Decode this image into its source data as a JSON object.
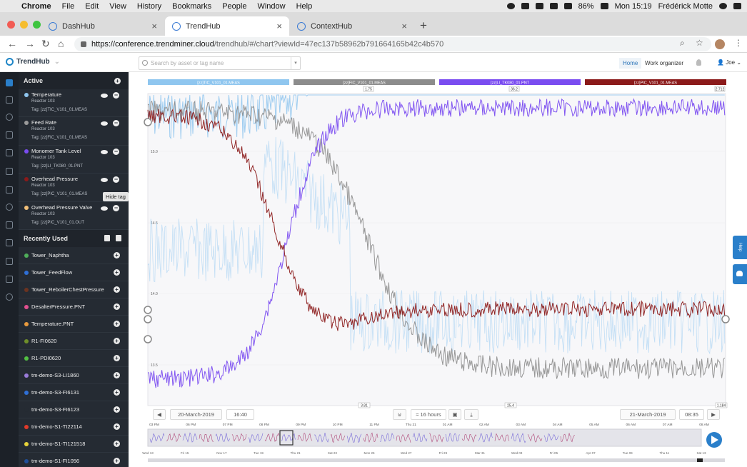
{
  "os_menubar": {
    "app": "Chrome",
    "menus": [
      "File",
      "Edit",
      "View",
      "History",
      "Bookmarks",
      "People",
      "Window",
      "Help"
    ],
    "battery": "86%",
    "clock": "Mon 15:19",
    "user": "Frédérick Motte"
  },
  "browser": {
    "tabs": [
      {
        "label": "DashHub",
        "active": false
      },
      {
        "label": "TrendHub",
        "active": true
      },
      {
        "label": "ContextHub",
        "active": false
      }
    ],
    "url_host": "https://conference.trendminer.cloud",
    "url_path": "/trendhub/#/chart?viewId=47ec137b58962b791664165b42c4b570"
  },
  "app": {
    "name": "TrendHub",
    "search_placeholder": "Search by asset or tag name",
    "nav": {
      "home": "Home",
      "work": "Work organizer"
    },
    "user": "Joe"
  },
  "panel": {
    "active_title": "Active",
    "active_tags": [
      {
        "name": "Temperature",
        "asset": "Reactor 103",
        "tag": "Tag: [zz]TIC_V101_01.MEAS",
        "color": "#8fc6ef"
      },
      {
        "name": "Feed Rate",
        "asset": "Reactor 103",
        "tag": "Tag: [zz]FIC_V101_01.MEAS",
        "color": "#9a9a9a"
      },
      {
        "name": "Monomer Tank Level",
        "asset": "Reactor 103",
        "tag": "Tag: [zz]LI_TK080_01.PNT",
        "color": "#7a4cf0"
      },
      {
        "name": "Overhead Pressure",
        "asset": "Reactor 103",
        "tag": "Tag: [zz]PIC_V101_01.MEAS",
        "color": "#8b1a1a"
      },
      {
        "name": "Overhead Pressure Valve",
        "asset": "Reactor 103",
        "tag": "Tag: [zz]PIC_V101_01.OUT",
        "color": "#f2c079"
      }
    ],
    "tooltip": "Hide tag",
    "recent_title": "Recently Used",
    "recent": [
      {
        "name": "Tower_Naphtha",
        "color": "#4fae5a"
      },
      {
        "name": "Tower_FeedFlow",
        "color": "#2f6fd6"
      },
      {
        "name": "Tower_ReboilerChestPressure",
        "color": "#6b3320"
      },
      {
        "name": "DesalterPressure.PNT",
        "color": "#e2508f"
      },
      {
        "name": "Temperature.PNT",
        "color": "#e89a3e"
      },
      {
        "name": "R1-FI0620",
        "color": "#6f8f2a"
      },
      {
        "name": "R1-PDI0620",
        "color": "#53c043"
      },
      {
        "name": "tm-demo-S3-LI1860",
        "color": "#9a7bd8"
      },
      {
        "name": "tm-demo-S3-FI6131",
        "color": "#2f6fd6"
      },
      {
        "name": "tm-demo-S3-FI6123",
        "color": "#252b33"
      },
      {
        "name": "tm-demo-S1-TI22114",
        "color": "#e03a2a"
      },
      {
        "name": "tm-demo-S1-TI121518",
        "color": "#e6d23a"
      },
      {
        "name": "tm-demo-S1-FI1056",
        "color": "#1f4f9a"
      }
    ]
  },
  "chart": {
    "scale_headers": [
      {
        "tag": "[zz]TIC_V101_01.MEAS",
        "color": "#8fc6ef",
        "max": ""
      },
      {
        "tag": "[zz]FIC_V101_01.MEAS",
        "color": "#8c8c8c",
        "max": "1.75"
      },
      {
        "tag": "[zz]LI_TK080_01.PNT",
        "color": "#7a4cf0",
        "max": "36.2"
      },
      {
        "tag": "[zz]PIC_V101_01.MEAS",
        "color": "#8b1a1a",
        "max": "2.712"
      }
    ],
    "y_ticks": [
      "15.0",
      "14.5",
      "14.0",
      "13.5"
    ],
    "x_ticks": [
      "03 PM",
      "06 PM",
      "07 PM",
      "08 PM",
      "09 PM",
      "10 PM",
      "11 PM",
      "Thu 21",
      "01 AM",
      "02 AM",
      "03 AM",
      "04 AM",
      "05 AM",
      "06 AM",
      "07 AM",
      "08 AM"
    ],
    "bottom_mins": [
      "3.81",
      "25.4",
      "1.184"
    ],
    "start_date": "20-March-2019",
    "start_time": "16:40",
    "span": "≈ 16 hours",
    "end_date": "21-March-2019",
    "end_time": "08:35",
    "overview_ticks": [
      "Wed 13",
      "Fri 15",
      "Nov 17",
      "Tue 19",
      "Thu 21",
      "Sat 23",
      "Mon 25",
      "Wed 27",
      "Fri 29",
      "Mar 31",
      "Wed 03",
      "Fri 05",
      "Apr 07",
      "Tue 09",
      "Thu 11",
      "Sat 13"
    ],
    "help": "Help"
  }
}
